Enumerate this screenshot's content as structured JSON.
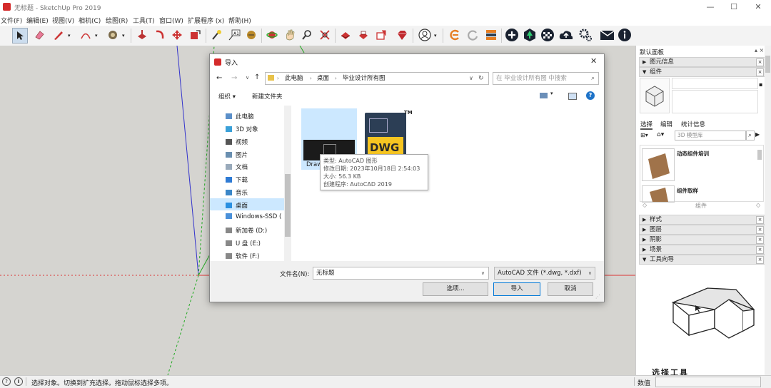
{
  "app": {
    "title": "无标题 - SketchUp Pro 2019",
    "window_controls": [
      "—",
      "☐",
      "✕"
    ]
  },
  "menubar": {
    "items": [
      "文件(F)",
      "编辑(E)",
      "视图(V)",
      "相机(C)",
      "绘图(R)",
      "工具(T)",
      "窗口(W)",
      "扩展程序 (x)",
      "帮助(H)"
    ]
  },
  "toolbar": {
    "icons": [
      "select-icon",
      "eraser-icon",
      "pencil-icon",
      "arc-icon",
      "paint-bucket-icon",
      "push-pull-icon",
      "follow-me-icon",
      "move-icon",
      "rotate-icon",
      "scale-icon",
      "tape-measure-icon",
      "text-icon",
      "dimension-icon",
      "orbit-icon",
      "pan-icon",
      "zoom-icon",
      "zoom-extents-icon",
      "warehouse-icon",
      "components-icon",
      "extensions-icon",
      "ruby-icon",
      "account-icon",
      "sync-icon",
      "refresh-icon",
      "layers-icon",
      "add-icon",
      "tree-icon",
      "checker-icon",
      "upload-icon",
      "settings-icon",
      "mail-icon",
      "info-icon"
    ]
  },
  "dialog": {
    "title": "导入",
    "close": "✕",
    "breadcrumb": [
      "此电脑",
      "桌面",
      "毕业设计所有图"
    ],
    "search_placeholder": "在 毕业设计所有图 中搜索",
    "organize": "组织 ▾",
    "new_folder": "新建文件夹",
    "help": "?",
    "nav_items": [
      {
        "label": "此电脑",
        "icon": "computer-icon"
      },
      {
        "label": "3D 对象",
        "icon": "3d-objects-icon"
      },
      {
        "label": "视频",
        "icon": "video-icon"
      },
      {
        "label": "图片",
        "icon": "pictures-icon"
      },
      {
        "label": "文档",
        "icon": "documents-icon"
      },
      {
        "label": "下载",
        "icon": "download-icon"
      },
      {
        "label": "音乐",
        "icon": "music-icon"
      },
      {
        "label": "桌面",
        "icon": "desktop-icon"
      },
      {
        "label": "Windows-SSD (",
        "icon": "drive-icon"
      },
      {
        "label": "新加卷 (D:)",
        "icon": "drive-icon"
      },
      {
        "label": "U 盘 (E:)",
        "icon": "drive-icon"
      },
      {
        "label": "软件 (F:)",
        "icon": "drive-icon"
      }
    ],
    "files": [
      {
        "name": "Draw",
        "type": "thumbnail"
      },
      {
        "name": "DWG",
        "type": "dwg"
      }
    ],
    "dwg_tm": "TM",
    "tooltip": {
      "type": "类型: AutoCAD 图形",
      "modified": "修改日期: 2023年10月18日 2:54:03",
      "size": "大小: 56.3 KB",
      "creator": "创建程序: AutoCAD 2019"
    },
    "filename_label": "文件名(N):",
    "filename_value": "无标题",
    "filetype": "AutoCAD 文件 (*.dwg, *.dxf)",
    "options_button": "选项...",
    "import_button": "导入",
    "cancel_button": "取消"
  },
  "tray": {
    "title": "默认面板",
    "pin": "▴ ×",
    "entity_info": "图元信息",
    "components": "组件",
    "tabs": [
      "选择",
      "编辑",
      "统计信息"
    ],
    "search_placeholder": "3D 模型库",
    "items": [
      "动态组件培训",
      "组件取样"
    ],
    "components_footer": "组件",
    "sections": [
      "样式",
      "图层",
      "阴影",
      "场景",
      "工具向导"
    ],
    "guide_caption": "选择工具"
  },
  "status": {
    "text": "选择对象。切换到扩充选择。拖动鼠标选择多项。",
    "measure_label": "数值"
  },
  "colors": {
    "accent": "#0078d7",
    "selected_nav": "#cce8ff",
    "sketchup_red": "#d42b2b",
    "axis_red": "#d33",
    "axis_green": "#2a2",
    "axis_blue": "#33c"
  }
}
